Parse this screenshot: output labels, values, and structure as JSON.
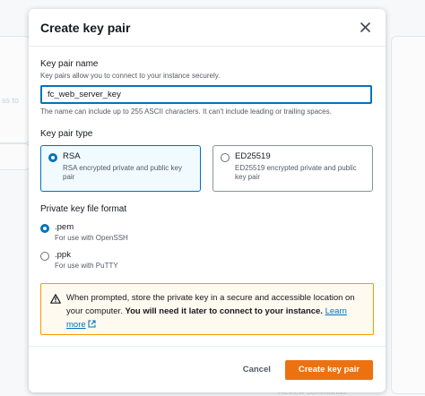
{
  "modal": {
    "title": "Create key pair",
    "key_pair_name": {
      "label": "Key pair name",
      "description": "Key pairs allow you to connect to your instance securely.",
      "value": "fc_web_server_key",
      "hint": "The name can include up to 255 ASCII characters. It can't include leading or trailing spaces."
    },
    "key_pair_type": {
      "label": "Key pair type",
      "options": [
        {
          "title": "RSA",
          "description": "RSA encrypted private and public key pair",
          "selected": true
        },
        {
          "title": "ED25519",
          "description": "ED25519 encrypted private and public key pair",
          "selected": false
        }
      ]
    },
    "file_format": {
      "label": "Private key file format",
      "options": [
        {
          "title": ".pem",
          "description": "For use with OpenSSH",
          "selected": true
        },
        {
          "title": ".ppk",
          "description": "For use with PuTTY",
          "selected": false
        }
      ]
    },
    "alert": {
      "text_before": "When prompted, store the private key in a secure and accessible location on your computer. ",
      "text_bold": "You will need it later to connect to your instance.",
      "link": "Learn more"
    },
    "footer": {
      "cancel": "Cancel",
      "create": "Create key pair"
    }
  },
  "background": {
    "fragment_left": "ss to",
    "fragment_bottom": "Review commands"
  },
  "colors": {
    "primary": "#ec7211",
    "link": "#0073bb",
    "warning": "#ff9900"
  }
}
